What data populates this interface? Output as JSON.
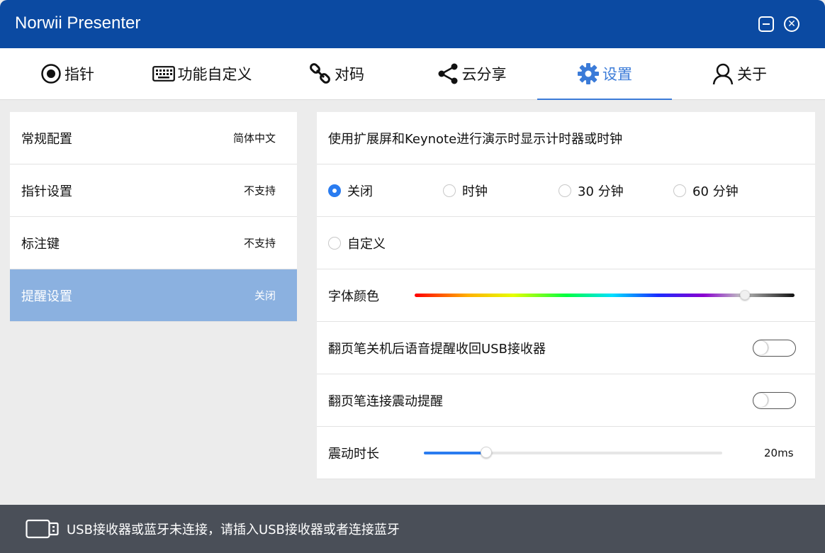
{
  "window": {
    "title": "Norwii Presenter",
    "minimize_icon": "minimize-icon",
    "close_icon": "close-icon",
    "close_glyph": "✕"
  },
  "tabs": [
    {
      "label": "指针",
      "icon": "pointer-icon"
    },
    {
      "label": "功能自定义",
      "icon": "keyboard-icon"
    },
    {
      "label": "对码",
      "icon": "link-icon"
    },
    {
      "label": "云分享",
      "icon": "share-icon"
    },
    {
      "label": "设置",
      "icon": "gear-icon",
      "active": true
    },
    {
      "label": "关于",
      "icon": "user-icon"
    }
  ],
  "sidebar": {
    "items": [
      {
        "label": "常规配置",
        "value": "简体中文"
      },
      {
        "label": "指针设置",
        "value": "不支持"
      },
      {
        "label": "标注键",
        "value": "不支持"
      },
      {
        "label": "提醒设置",
        "value": "关闭",
        "active": true
      }
    ]
  },
  "settings": {
    "description": "使用扩展屏和Keynote进行演示时显示计时器或时钟",
    "timer_options": [
      {
        "label": "关闭",
        "checked": true
      },
      {
        "label": "时钟",
        "checked": false
      },
      {
        "label": "30 分钟",
        "checked": false
      },
      {
        "label": "60 分钟",
        "checked": false
      },
      {
        "label": "自定义",
        "checked": false
      }
    ],
    "font_color_label": "字体颜色",
    "font_color_position": 0.87,
    "usb_reminder_label": "翻页笔关机后语音提醒收回USB接收器",
    "usb_reminder_on": false,
    "vibrate_connect_label": "翻页笔连接震动提醒",
    "vibrate_connect_on": false,
    "vibration_duration_label": "震动时长",
    "vibration_duration_value": "20ms",
    "vibration_duration_fraction": 0.21
  },
  "status": {
    "icon": "usb-icon",
    "message": "USB接收器或蓝牙未连接，请插入USB接收器或者连接蓝牙"
  },
  "colors": {
    "titlebar": "#0b4aa2",
    "accent": "#3b7bd8",
    "sidebar_active": "#8bb1e0",
    "statusbar": "#4a4f58"
  }
}
